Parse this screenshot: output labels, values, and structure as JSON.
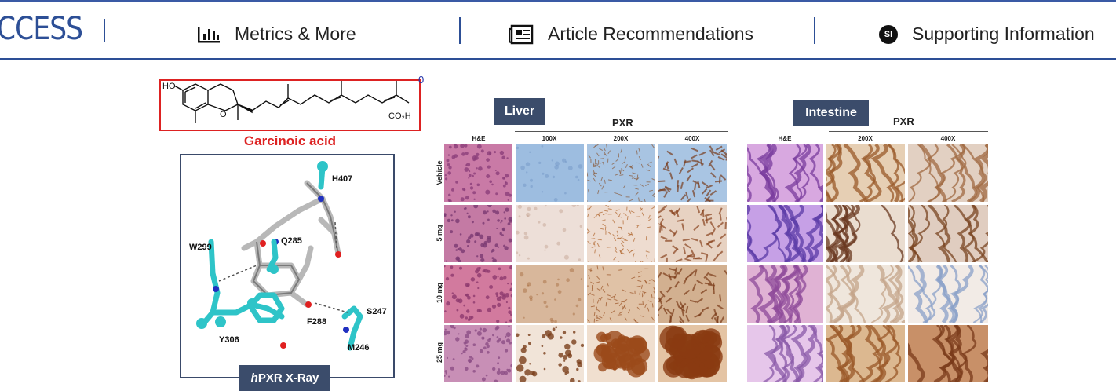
{
  "nav": {
    "access_label": "CCESS",
    "metrics_label": "Metrics & More",
    "recommendations_label": "Article Recommendations",
    "si_badge": "SI",
    "supporting_label": "Supporting Information"
  },
  "figure": {
    "corner_number": "0",
    "compound_name": "Garcinoic acid",
    "structure_text": {
      "ho": "HO",
      "o": "O",
      "acid": "CO₂H"
    },
    "xray_label_italic": "h",
    "xray_label_rest": "PXR X-Ray",
    "residues": [
      "H407",
      "Q285",
      "W299",
      "S247",
      "F288",
      "Y306",
      "M246"
    ],
    "liver": {
      "title": "Liver",
      "pxr_label": "PXR",
      "columns": [
        "H&E",
        "100X",
        "200X",
        "400X"
      ],
      "rows": [
        "Vehicle",
        "5 mg",
        "10 mg",
        "25 mg"
      ]
    },
    "intestine": {
      "title": "Intestine",
      "pxr_label": "PXR",
      "columns": [
        "H&E",
        "200X",
        "400X"
      ]
    }
  },
  "colors": {
    "accent_blue": "#2d4f96",
    "panel_title_bg": "#3b4c6b",
    "compound_red": "#dd2222",
    "protein_cyan": "#2ec4c8",
    "ligand_gray": "#c8c8c8"
  }
}
